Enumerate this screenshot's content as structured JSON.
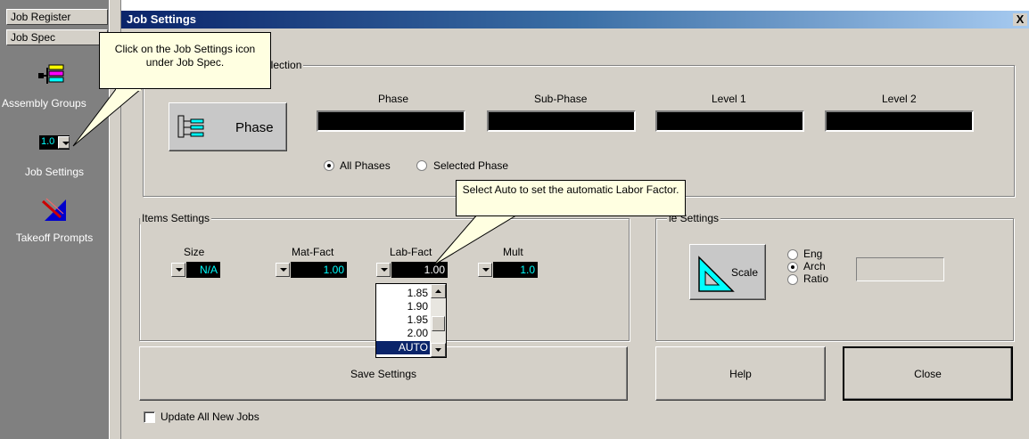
{
  "left_panel": {
    "tabs": [
      "Job Register",
      "Job Spec"
    ],
    "items": [
      {
        "label": "Assembly Groups",
        "icon": "assembly-groups-icon"
      },
      {
        "label": "Job Settings",
        "icon": "job-settings-icon",
        "badge": "1.0"
      },
      {
        "label": "Takeoff Prompts",
        "icon": "takeoff-prompts-icon"
      }
    ]
  },
  "dialog": {
    "title": "Job Settings",
    "close_glyph": "X",
    "phase_selection": {
      "legend": "election",
      "phase_button_label": "Phase",
      "columns": [
        "Phase",
        "Sub-Phase",
        "Level 1",
        "Level 2"
      ],
      "radios": [
        {
          "label": "All Phases",
          "checked": true
        },
        {
          "label": "Selected Phase",
          "checked": false
        }
      ]
    },
    "items_settings": {
      "legend": "Items Settings",
      "fields": [
        {
          "label": "Size",
          "value": "N/A"
        },
        {
          "label": "Mat-Fact",
          "value": "1.00"
        },
        {
          "label": "Lab-Fact",
          "value": "1.00"
        },
        {
          "label": "Mult",
          "value": "1.0"
        }
      ],
      "dropdown_options": [
        "1.85",
        "1.90",
        "1.95",
        "2.00",
        "AUTO"
      ],
      "dropdown_selected": "AUTO"
    },
    "scale_settings": {
      "legend": "le Settings",
      "button_label": "Scale",
      "radios": [
        {
          "label": "Eng",
          "checked": false
        },
        {
          "label": "Arch",
          "checked": true
        },
        {
          "label": "Ratio",
          "checked": false
        }
      ]
    },
    "buttons": {
      "save": "Save Settings",
      "help": "Help",
      "close": "Close"
    },
    "update_checkbox": {
      "label": "Update All New Jobs",
      "checked": false
    }
  },
  "callouts": {
    "job_settings_tip": "Click on the Job Settings icon under Job Spec.",
    "auto_tip": "Select Auto to set the automatic Labor Factor."
  },
  "colors": {
    "title_bar": "#0a246a",
    "dialog_bg": "#d4d0c8",
    "field_text": "#00ffff",
    "tooltip_bg": "#ffffe1",
    "selection": "#0a246a"
  }
}
